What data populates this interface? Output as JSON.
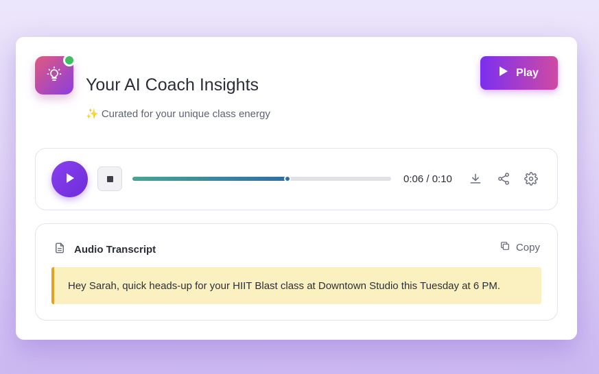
{
  "header": {
    "title": "Your AI Coach Insights",
    "subtitle": "✨ Curated for your unique class energy",
    "play_label": "Play",
    "icon": "lightbulb-icon",
    "status": "online"
  },
  "player": {
    "time": "0:06 / 0:10",
    "progress": 0.6,
    "actions": [
      "download-icon",
      "share-icon",
      "settings-icon"
    ]
  },
  "transcript": {
    "title": "Audio Transcript",
    "copy_label": "Copy",
    "text": "Hey Sarah, quick heads-up for your HIIT Blast class at Downtown Studio this Tuesday at 6 PM."
  },
  "colors": {
    "accent_purple": "#7b2ff0",
    "accent_pink": "#cf4aa3",
    "progress_start": "#4aa396",
    "progress_end": "#2f6fa2",
    "highlight_bg": "#fbf1c0",
    "highlight_border": "#e0a422",
    "status_green": "#3fbf5f"
  }
}
